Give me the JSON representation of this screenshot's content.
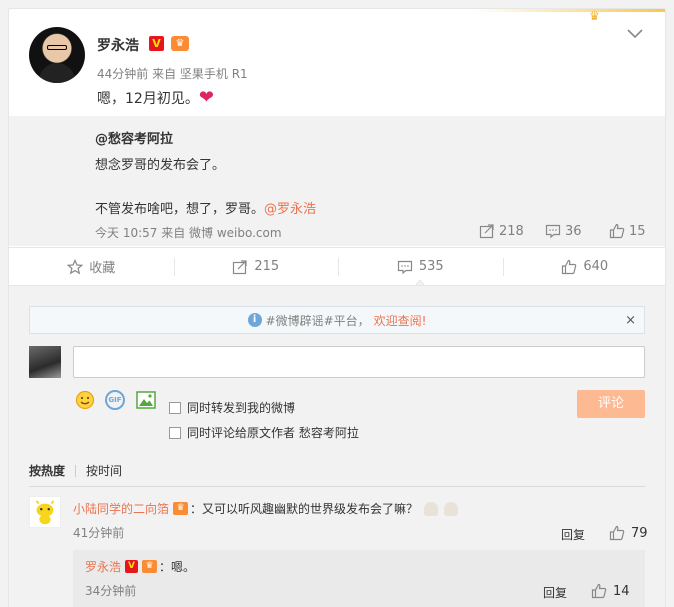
{
  "post": {
    "author": "罗永浩",
    "meta": "44分钟前 来自 坚果手机 R1",
    "content": "嗯，12月初见。",
    "verified_badge": "V",
    "emoji": "heart"
  },
  "repost": {
    "author": "@愁容考阿拉",
    "line1": "想念罗哥的发布会了。",
    "line2_prefix": "不管发布啥吧，想了，罗哥。",
    "line2_mention": "@罗永浩",
    "meta": "今天 10:57 来自 微博 weibo.com",
    "reposts": "218",
    "comments": "36",
    "likes": "15"
  },
  "actions": {
    "favorite": "收藏",
    "repost": "215",
    "comment": "535",
    "like": "640"
  },
  "notice": {
    "text": "#微博辟谣#平台，",
    "link": "欢迎查阅!",
    "close": "×"
  },
  "compose": {
    "repost_check": "同时转发到我的微博",
    "comment_check": "同时评论给原文作者 愁容考阿拉",
    "submit": "评论"
  },
  "sort": {
    "hot": "按热度",
    "time": "按时间"
  },
  "comments": [
    {
      "user": "小陆同学的二向箔",
      "text": "：又可以听风趣幽默的世界级发布会了嘛？",
      "time": "41分钟前",
      "reply": "回复",
      "likes": "79"
    }
  ],
  "sub_comment": {
    "user": "罗永浩",
    "text": "：嗯。",
    "time": "34分钟前",
    "reply": "回复",
    "likes": "14"
  },
  "colors": {
    "accent": "#eb7350",
    "submit_bg": "#fdb991",
    "muted": "#808080",
    "badge_red": "#e6161d"
  }
}
